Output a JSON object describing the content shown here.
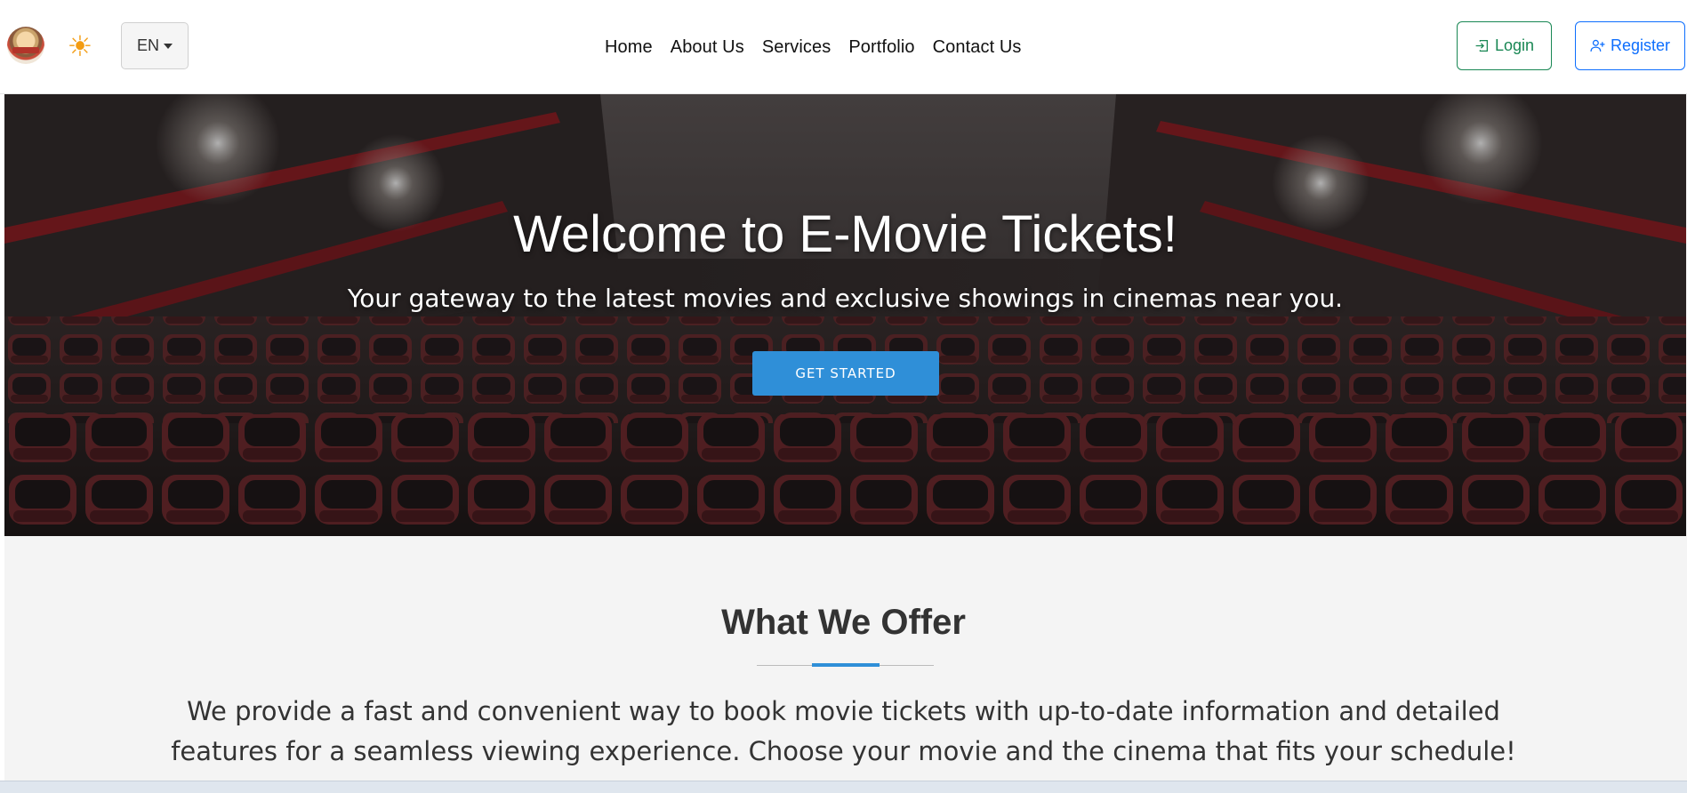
{
  "header": {
    "lang_label": "EN",
    "nav": [
      {
        "label": "Home"
      },
      {
        "label": "About Us"
      },
      {
        "label": "Services"
      },
      {
        "label": "Portfolio"
      },
      {
        "label": "Contact Us"
      }
    ],
    "login_label": "Login",
    "register_label": "Register",
    "icons": {
      "logo": "cinema-logo",
      "theme": "sun-icon",
      "login": "login-icon",
      "register": "person-plus-icon"
    }
  },
  "hero": {
    "title": "Welcome to E-Movie Tickets!",
    "subtitle": "Your gateway to the latest movies and exclusive showings in cinemas near you.",
    "cta_label": "GET STARTED"
  },
  "offer": {
    "title": "What We Offer",
    "text": "We provide a fast and convenient way to book movie tickets with up-to-date information and detailed features for a seamless viewing experience. Choose your movie and the cinema that fits your schedule!"
  },
  "colors": {
    "accent": "#2f8fd8",
    "login": "#198754",
    "register": "#0d6efd",
    "sun": "#f39c12"
  }
}
